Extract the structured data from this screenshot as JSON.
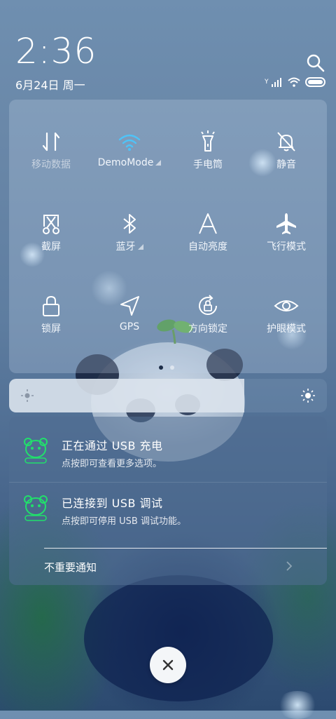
{
  "status_bar": {
    "time": "2:36",
    "date": "6月24日 周一",
    "signal_text": "Y"
  },
  "quick_settings": {
    "tiles": [
      {
        "label": "移动数据",
        "icon": "mobile-data-icon",
        "active": false
      },
      {
        "label": "DemoMode",
        "icon": "wifi-icon",
        "active": true
      },
      {
        "label": "手电筒",
        "icon": "flashlight-icon",
        "active": false
      },
      {
        "label": "静音",
        "icon": "bell-off-icon",
        "active": false
      },
      {
        "label": "截屏",
        "icon": "screenshot-icon",
        "active": false
      },
      {
        "label": "蓝牙",
        "icon": "bluetooth-icon",
        "active": false
      },
      {
        "label": "自动亮度",
        "icon": "auto-brightness-icon",
        "active": false
      },
      {
        "label": "飞行模式",
        "icon": "airplane-icon",
        "active": false
      },
      {
        "label": "锁屏",
        "icon": "lock-icon",
        "active": false
      },
      {
        "label": "GPS",
        "icon": "gps-icon",
        "active": false
      },
      {
        "label": "方向锁定",
        "icon": "rotation-lock-icon",
        "active": false
      },
      {
        "label": "护眼模式",
        "icon": "eye-icon",
        "active": false
      }
    ],
    "page_indicator": {
      "current": 1,
      "total": 2
    }
  },
  "brightness": {
    "level": 0.74
  },
  "notifications": [
    {
      "title": "正在通过 USB 充电",
      "subtitle": "点按即可查看更多选项。",
      "app_icon": "panda-app-icon"
    },
    {
      "title": "已连接到 USB 调试",
      "subtitle": "点按即可停用 USB 调试功能。",
      "app_icon": "panda-app-icon"
    }
  ],
  "unimportant_notifications_label": "不重要通知",
  "colors": {
    "accent_active": "#4fc3f7",
    "app_icon_green": "#21e06b"
  }
}
